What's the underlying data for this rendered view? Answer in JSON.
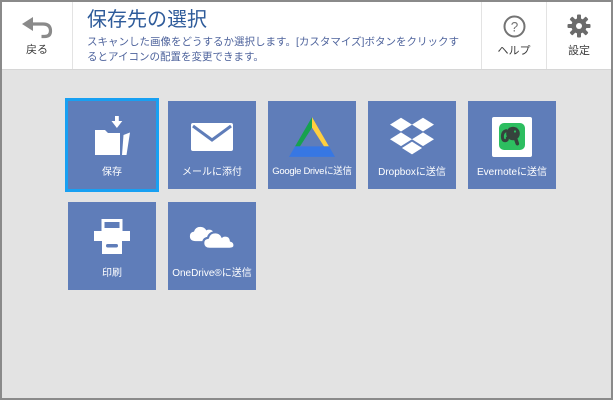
{
  "theme": {
    "window_bg": "#e3e3e3",
    "window_border": "#8a8a8a",
    "header_bg": "#ffffff",
    "title_color": "#2e5b9a",
    "subtitle_color": "#4e639c",
    "header_label_color": "#3d3d3d",
    "icon_gray": "#8a8a8a",
    "tile_bg": "#5f7db9",
    "tile_text": "#ffffff",
    "accent": "#18a0f2"
  },
  "header": {
    "back": {
      "label": "戻る",
      "icon": "back-arrow-icon"
    },
    "title": "保存先の選択",
    "subtitle": "スキャンした画像をどうするか選択します。[カスタマイズ]ボタンをクリックするとアイコンの配置を変更できます。",
    "help": {
      "label": "ヘルプ",
      "icon": "help-icon"
    },
    "settings": {
      "label": "設定",
      "icon": "gear-icon"
    }
  },
  "tiles": {
    "rows": [
      [
        {
          "label": "保存",
          "icon": "save-folder-icon",
          "selected": true
        },
        {
          "label": "メールに添付",
          "icon": "email-icon",
          "selected": false
        },
        {
          "label": "Google Driveに送信",
          "icon": "google-drive-icon",
          "selected": false
        },
        {
          "label": "Dropboxに送信",
          "icon": "dropbox-icon",
          "selected": false
        },
        {
          "label": "Evernoteに送信",
          "icon": "evernote-icon",
          "selected": false
        }
      ],
      [
        {
          "label": "印刷",
          "icon": "printer-icon",
          "selected": false
        },
        {
          "label": "OneDrive®に送信",
          "icon": "onedrive-cloud-icon",
          "selected": false
        }
      ]
    ]
  },
  "brand_colors": {
    "drive_green": "#16a24e",
    "drive_yellow": "#ffcf3f",
    "drive_blue": "#3777e3",
    "evernote_green": "#2dbe60",
    "evernote_elephant": "#35433c"
  }
}
